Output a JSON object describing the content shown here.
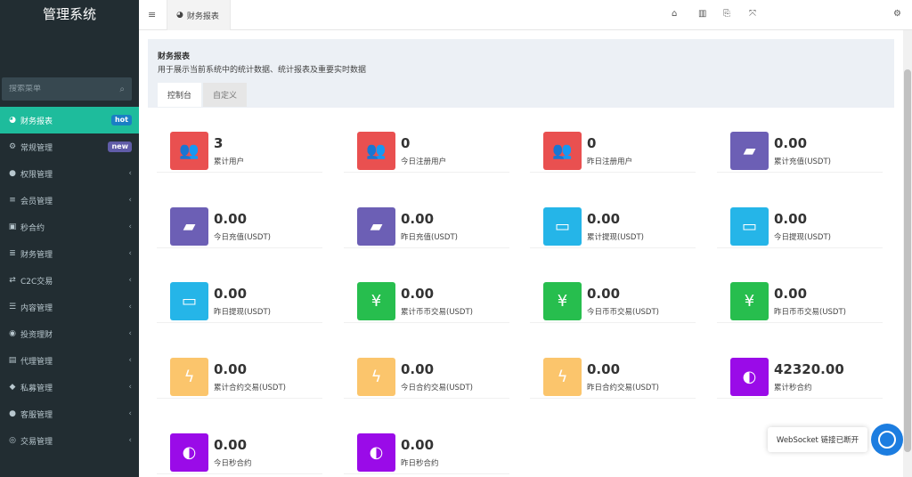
{
  "brand": "管理系统",
  "search": {
    "placeholder": "搜索菜单"
  },
  "menu": [
    {
      "icon": "dashboard-icon",
      "glyph": "◕",
      "label": "财务报表",
      "badge": "hot",
      "active": true
    },
    {
      "icon": "cogs-icon",
      "glyph": "⚙",
      "label": "常规管理",
      "badge": "new"
    },
    {
      "icon": "group-icon",
      "glyph": "●",
      "label": "权限管理",
      "chev": "‹"
    },
    {
      "icon": "list-icon",
      "glyph": "≡",
      "label": "会员管理",
      "chev": "‹"
    },
    {
      "icon": "calendar-icon",
      "glyph": "▣",
      "label": "秒合约",
      "chev": "‹"
    },
    {
      "icon": "database-icon",
      "glyph": "≣",
      "label": "财务管理",
      "chev": "‹"
    },
    {
      "icon": "exchange-icon",
      "glyph": "⇄",
      "label": "C2C交易",
      "chev": "‹"
    },
    {
      "icon": "content-icon",
      "glyph": "☰",
      "label": "内容管理",
      "chev": "‹"
    },
    {
      "icon": "compass-icon",
      "glyph": "◉",
      "label": "投资理财",
      "chev": "‹"
    },
    {
      "icon": "briefcase-icon",
      "glyph": "▤",
      "label": "代理管理",
      "chev": "‹"
    },
    {
      "icon": "diamond-icon",
      "glyph": "◆",
      "label": "私募管理",
      "chev": "‹"
    },
    {
      "icon": "comment-icon",
      "glyph": "●",
      "label": "客服管理",
      "chev": "‹"
    },
    {
      "icon": "eye-icon",
      "glyph": "◎",
      "label": "交易管理",
      "chev": "‹"
    }
  ],
  "topbar": {
    "tab_label": "财务报表",
    "icons": [
      "home-icon",
      "trash-icon",
      "translate-icon",
      "fullscreen-icon",
      "settings-icon"
    ]
  },
  "panel": {
    "title": "财务报表",
    "subtitle": "用于展示当前系统中的统计数据、统计报表及重要实时数据",
    "tabs": [
      "控制台",
      "自定义"
    ]
  },
  "stats": [
    {
      "value": "3",
      "label": "累计用户",
      "color": "red",
      "glyph": "👥"
    },
    {
      "value": "0",
      "label": "今日注册用户",
      "color": "red",
      "glyph": "👥"
    },
    {
      "value": "0",
      "label": "昨日注册用户",
      "color": "red",
      "glyph": "👥"
    },
    {
      "value": "0.00",
      "label": "累计充值(USDT)",
      "color": "purple",
      "glyph": "▰"
    },
    {
      "value": "0.00",
      "label": "今日充值(USDT)",
      "color": "purple",
      "glyph": "▰"
    },
    {
      "value": "0.00",
      "label": "昨日充值(USDT)",
      "color": "purple",
      "glyph": "▰"
    },
    {
      "value": "0.00",
      "label": "累计提现(USDT)",
      "color": "cyan",
      "glyph": "▭"
    },
    {
      "value": "0.00",
      "label": "今日提现(USDT)",
      "color": "cyan",
      "glyph": "▭"
    },
    {
      "value": "0.00",
      "label": "昨日提现(USDT)",
      "color": "cyan",
      "glyph": "▭"
    },
    {
      "value": "0.00",
      "label": "累计币币交易(USDT)",
      "color": "green",
      "glyph": "¥"
    },
    {
      "value": "0.00",
      "label": "今日币币交易(USDT)",
      "color": "green",
      "glyph": "¥"
    },
    {
      "value": "0.00",
      "label": "昨日币币交易(USDT)",
      "color": "green",
      "glyph": "¥"
    },
    {
      "value": "0.00",
      "label": "累计合约交易(USDT)",
      "color": "yellow",
      "glyph": "ϟ"
    },
    {
      "value": "0.00",
      "label": "今日合约交易(USDT)",
      "color": "yellow",
      "glyph": "ϟ"
    },
    {
      "value": "0.00",
      "label": "昨日合约交易(USDT)",
      "color": "yellow",
      "glyph": "ϟ"
    },
    {
      "value": "42320.00",
      "label": "累计秒合约",
      "color": "violet",
      "glyph": "◐"
    },
    {
      "value": "0.00",
      "label": "今日秒合约",
      "color": "violet",
      "glyph": "◐"
    },
    {
      "value": "0.00",
      "label": "昨日秒合约",
      "color": "violet",
      "glyph": "◐"
    }
  ],
  "websocket_status": "WebSocket 链接已断开",
  "colors": {
    "sidebar": "#222d32",
    "active": "#1ebc9c",
    "red": "#e95050",
    "purple": "#6c5fb5",
    "cyan": "#25b5e8",
    "green": "#27be4e",
    "yellow": "#fbc56c",
    "violet": "#9a0be8"
  }
}
